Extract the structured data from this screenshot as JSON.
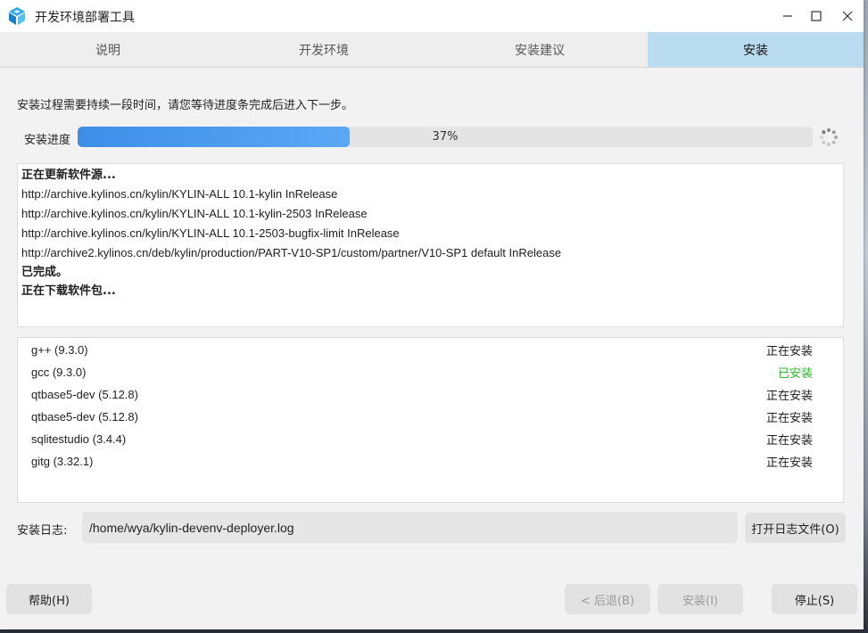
{
  "window": {
    "title": "开发环境部署工具",
    "icon": "app-cube-icon"
  },
  "tabs": [
    {
      "label": "说明",
      "active": false
    },
    {
      "label": "开发环境",
      "active": false
    },
    {
      "label": "安装建议",
      "active": false
    },
    {
      "label": "安装",
      "active": true
    }
  ],
  "instruction": "安装过程需要持续一段时间，请您等待进度条完成后进入下一步。",
  "progress": {
    "label": "安装进度",
    "percent": 37,
    "text": "37%"
  },
  "log_lines": [
    {
      "text": "正在更新软件源...",
      "bold": true
    },
    {
      "text": "http://archive.kylinos.cn/kylin/KYLIN-ALL 10.1-kylin InRelease",
      "bold": false
    },
    {
      "text": "http://archive.kylinos.cn/kylin/KYLIN-ALL 10.1-kylin-2503 InRelease",
      "bold": false
    },
    {
      "text": "http://archive.kylinos.cn/kylin/KYLIN-ALL 10.1-2503-bugfix-limit InRelease",
      "bold": false
    },
    {
      "text": "http://archive2.kylinos.cn/deb/kylin/production/PART-V10-SP1/custom/partner/V10-SP1 default InRelease",
      "bold": false
    },
    {
      "text": "已完成。",
      "bold": true
    },
    {
      "text": "正在下载软件包...",
      "bold": true
    }
  ],
  "packages": [
    {
      "name": "g++ (9.3.0)",
      "status": "正在安装",
      "done": false
    },
    {
      "name": "gcc (9.3.0)",
      "status": "已安装",
      "done": true
    },
    {
      "name": "qtbase5-dev (5.12.8)",
      "status": "正在安装",
      "done": false
    },
    {
      "name": "qtbase5-dev (5.12.8)",
      "status": "正在安装",
      "done": false
    },
    {
      "name": "sqlitestudio (3.4.4)",
      "status": "正在安装",
      "done": false
    },
    {
      "name": "gitg (3.32.1)",
      "status": "正在安装",
      "done": false
    }
  ],
  "install_log": {
    "label": "安装日志:",
    "path": "/home/wya/kylin-devenv-deployer.log",
    "open_button": "打开日志文件(O)"
  },
  "buttons": {
    "help": "帮助(H)",
    "back": "< 后退(B)",
    "install": "安装(I)",
    "stop": "停止(S)"
  },
  "colors": {
    "active_tab": "#b9dcf1",
    "progress_fill": "#4a9bef",
    "installed_status": "#2fb52f"
  }
}
